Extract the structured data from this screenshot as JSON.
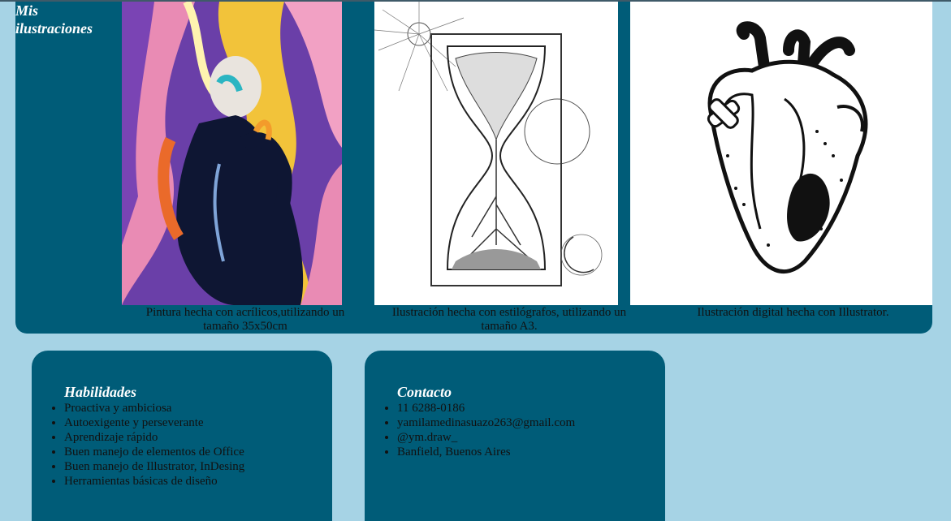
{
  "gallery": {
    "title_line1": "Mis",
    "title_line2": "ilustraciones",
    "items": [
      {
        "caption": "Pintura hecha con acrílicos,utilizando un tamaño 35x50cm",
        "image": "acrylic-painting-figure"
      },
      {
        "caption": "Ilustración hecha con estilógrafos, utilizando un tamaño A3.",
        "image": "ink-hourglass-tree"
      },
      {
        "caption": "Ilustración digital hecha con Illustrator.",
        "image": "digital-anatomical-heart"
      }
    ]
  },
  "skills": {
    "title": "Habilidades",
    "items": [
      "Proactiva y ambiciosa",
      "Autoexigente y perseverante",
      "Aprendizaje rápido",
      "Buen manejo de elementos de Office",
      "Buen manejo de Illustrator, InDesing",
      "Herramientas básicas de diseño"
    ]
  },
  "contact": {
    "title": "Contacto",
    "items": [
      "11 6288-0186",
      "yamilamedinasuazo263@gmail.com",
      "@ym.draw_",
      "Banfield, Buenos Aires"
    ]
  },
  "colors": {
    "page_background": "#a6d3e5",
    "panel": "#005c78",
    "heading_text": "#ffffff"
  }
}
